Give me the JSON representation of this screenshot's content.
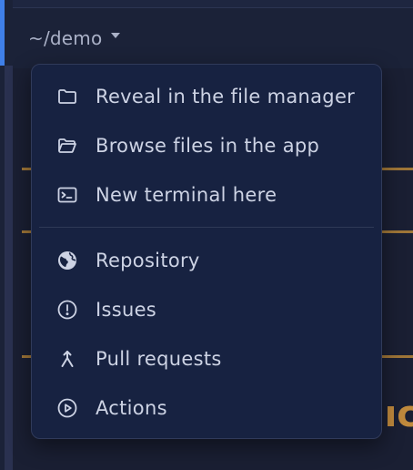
{
  "header": {
    "path": "~/demo"
  },
  "menu": {
    "items": [
      {
        "label": "Reveal in the file manager",
        "icon": "folder-icon"
      },
      {
        "label": "Browse files in the app",
        "icon": "folder-open-icon"
      },
      {
        "label": "New terminal here",
        "icon": "terminal-icon"
      },
      {
        "label": "Repository",
        "icon": "globe-icon"
      },
      {
        "label": "Issues",
        "icon": "issue-icon"
      },
      {
        "label": "Pull requests",
        "icon": "pull-request-icon"
      },
      {
        "label": "Actions",
        "icon": "play-circle-icon"
      }
    ]
  },
  "colors": {
    "menu_bg": "#172241",
    "menu_border": "#303a5a",
    "text": "#cdd3e4",
    "accent": "#3f7fe8",
    "background_orange": "#b7863a"
  }
}
